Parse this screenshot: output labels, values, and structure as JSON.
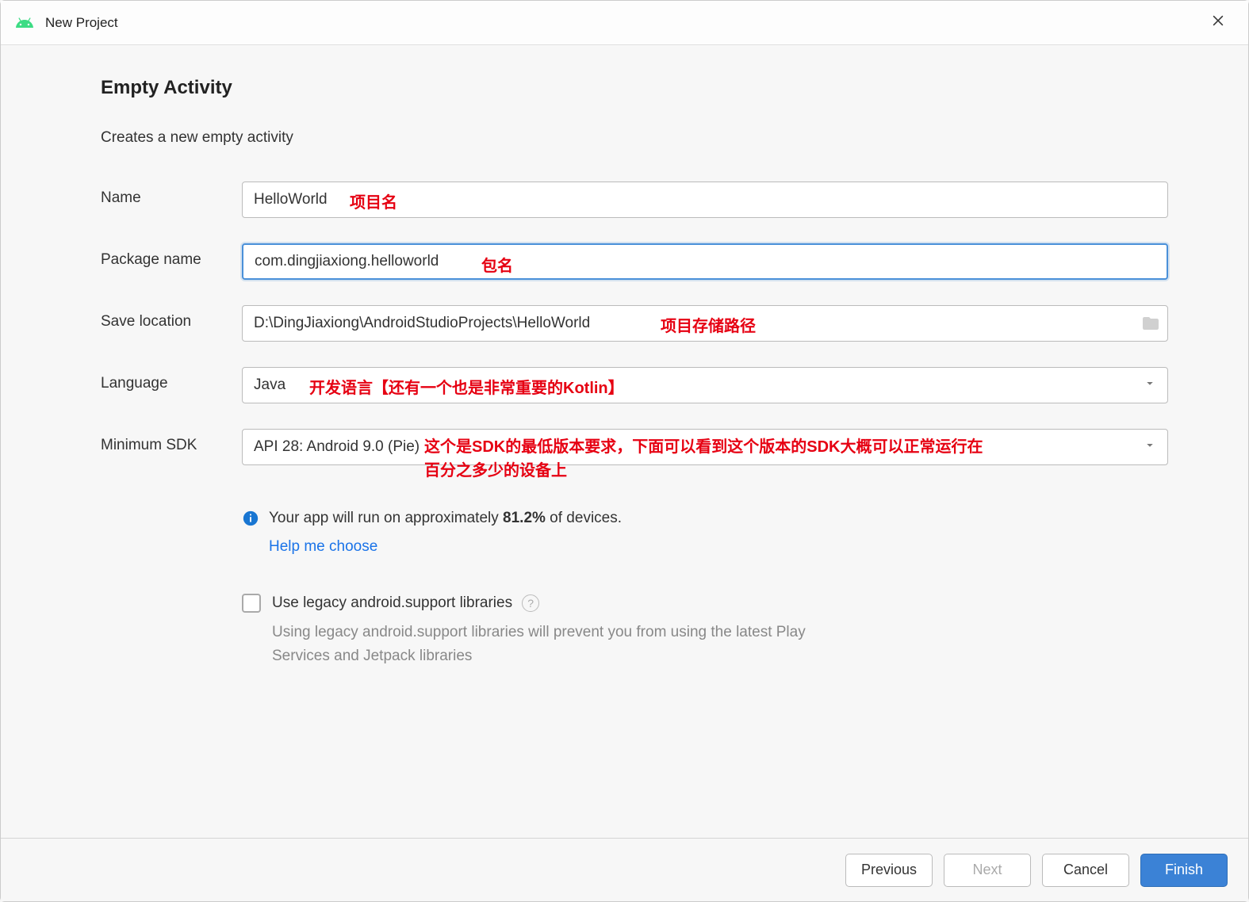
{
  "titlebar": {
    "title": "New Project"
  },
  "header": {
    "heading": "Empty Activity",
    "subtitle": "Creates a new empty activity"
  },
  "form": {
    "name": {
      "label": "Name",
      "value": "HelloWorld",
      "annotation": "项目名"
    },
    "package_name": {
      "label": "Package name",
      "value": "com.dingjiaxiong.helloworld",
      "annotation": "包名"
    },
    "save_location": {
      "label": "Save location",
      "value": "D:\\DingJiaxiong\\AndroidStudioProjects\\HelloWorld",
      "annotation": "项目存储路径"
    },
    "language": {
      "label": "Language",
      "value": "Java",
      "annotation": "开发语言【还有一个也是非常重要的Kotlin】"
    },
    "min_sdk": {
      "label": "Minimum SDK",
      "value": "API 28: Android 9.0 (Pie)",
      "annotation_line1": "这个是SDK的最低版本要求，下面可以看到这个版本的SDK大概可以正常运行在",
      "annotation_line2": "百分之多少的设备上",
      "info_prefix": "Your app will run on approximately ",
      "info_percent": "81.2%",
      "info_suffix": " of devices.",
      "help_link": "Help me choose"
    },
    "legacy": {
      "label": "Use legacy android.support libraries",
      "desc": "Using legacy android.support libraries will prevent you from using the latest Play Services and Jetpack libraries"
    }
  },
  "buttons": {
    "previous": "Previous",
    "next": "Next",
    "cancel": "Cancel",
    "finish": "Finish"
  }
}
